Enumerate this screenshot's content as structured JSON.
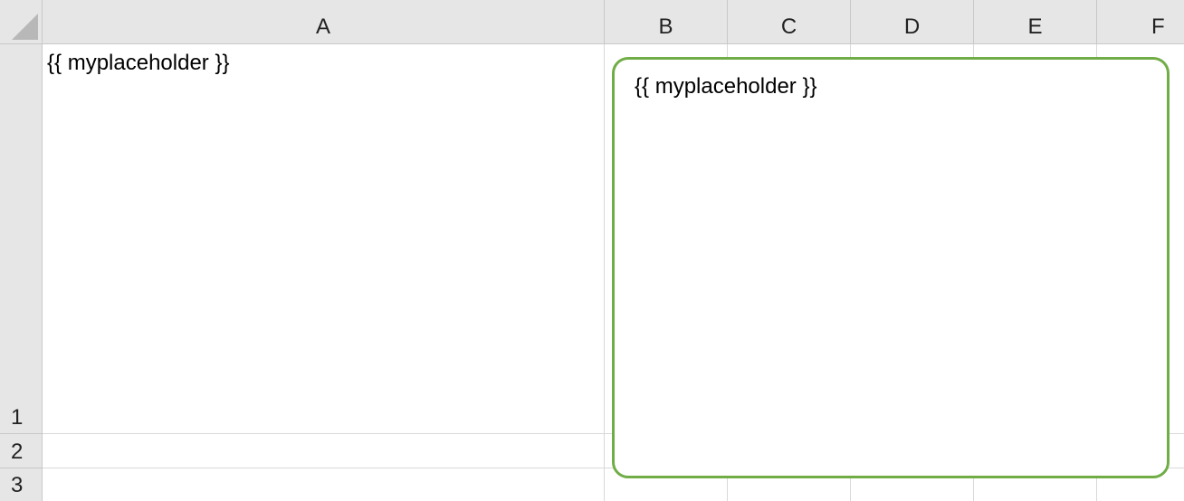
{
  "columns": [
    "A",
    "B",
    "C",
    "D",
    "E",
    "F"
  ],
  "rows": [
    "1",
    "2",
    "3"
  ],
  "cells": {
    "A1": "{{ myplaceholder }}"
  },
  "shape": {
    "text": "{{ myplaceholder }}",
    "border_color": "#70ad47"
  }
}
